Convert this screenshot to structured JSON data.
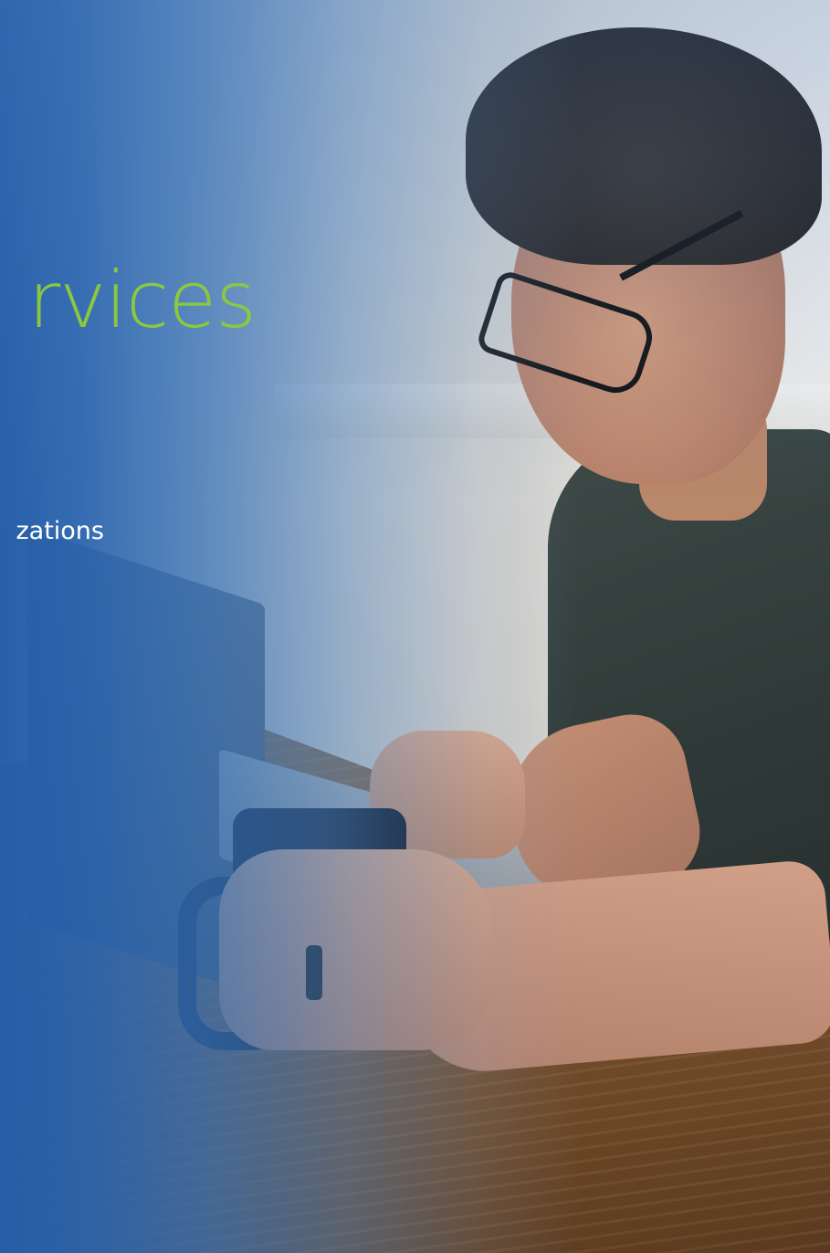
{
  "hero": {
    "headline": "rvices",
    "subtext": "zations"
  },
  "colors": {
    "headline": "#8cc83f",
    "overlay_blue": "#245ea8",
    "subtext": "#ffffff"
  }
}
